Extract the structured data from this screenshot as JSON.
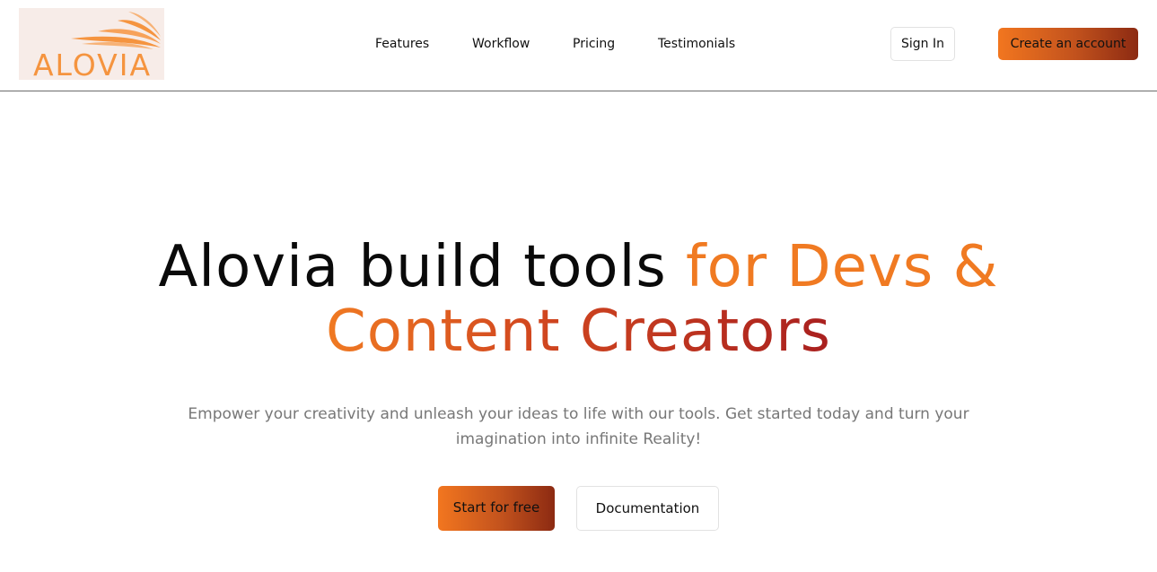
{
  "brand": {
    "logo_text": "ALOVIA",
    "logo_color": "#f5943f"
  },
  "nav": {
    "links": [
      "Features",
      "Workflow",
      "Pricing",
      "Testimonials"
    ],
    "sign_in_label": "Sign In",
    "create_account_label": "Create an account"
  },
  "hero": {
    "title_plain": "Alovia build tools ",
    "title_accent_1": "for Devs &",
    "title_accent_2": "Content Creators",
    "subtitle": "Empower your creativity and unleash your ideas to life with our tools. Get started today and turn your imagination into infinite Reality!",
    "primary_cta": "Start for free",
    "secondary_cta": "Documentation"
  },
  "colors": {
    "accent_start": "#f2761f",
    "accent_end": "#8c2a12",
    "title_gradient_end": "#a9201f"
  }
}
